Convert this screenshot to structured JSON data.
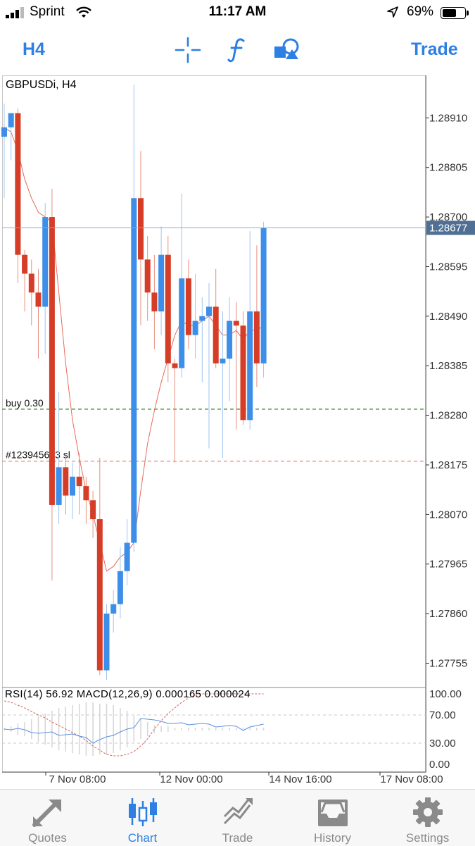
{
  "status": {
    "carrier": "Sprint",
    "time": "11:17 AM",
    "battery": "69%",
    "battery_level": 0.69
  },
  "toolbar": {
    "timeframe": "H4",
    "trade_label": "Trade",
    "icons": [
      "crosshair-icon",
      "function-icon",
      "objects-icon"
    ]
  },
  "chart": {
    "symbol_label": "GBPUSDi, H4",
    "indicator_label": "RSI(14) 56.92 MACD(12,26,9) 0.000165 0.000024",
    "current_price": "1.28677",
    "price_ticks": [
      "1.28910",
      "1.28805",
      "1.28700",
      "1.28595",
      "1.28490",
      "1.28385",
      "1.28280",
      "1.28175",
      "1.28070",
      "1.27965",
      "1.27860",
      "1.27755"
    ],
    "indicator_ticks": [
      "100.00",
      "70.00",
      "30.00",
      "0.00"
    ],
    "time_ticks": [
      "7 Nov 08:00",
      "12 Nov 00:00",
      "14 Nov 16:00",
      "17 Nov 08:00"
    ],
    "orders": [
      {
        "label": "buy 0.30",
        "price": 1.28293,
        "color": "#2e7d1e",
        "style": "dashed"
      },
      {
        "label": "#123945603 sl",
        "price": 1.28183,
        "color": "#f08070",
        "style": "dashed"
      }
    ],
    "colors": {
      "bull": "#3d8ee8",
      "bear": "#d63d27",
      "ma": "#e86a5a",
      "current": "#8da8c8",
      "axis": "#333333"
    }
  },
  "chart_data": {
    "type": "candlestick",
    "title": "GBPUSDi, H4",
    "ylim": [
      1.27705,
      1.29
    ],
    "candles": [
      {
        "o": 1.2887,
        "h": 1.2894,
        "l": 1.2874,
        "c": 1.2889
      },
      {
        "o": 1.2889,
        "h": 1.2891,
        "l": 1.2882,
        "c": 1.2892
      },
      {
        "o": 1.2892,
        "h": 1.2893,
        "l": 1.2856,
        "c": 1.2862
      },
      {
        "o": 1.2862,
        "h": 1.2863,
        "l": 1.285,
        "c": 1.2858
      },
      {
        "o": 1.2858,
        "h": 1.2861,
        "l": 1.2847,
        "c": 1.2854
      },
      {
        "o": 1.2854,
        "h": 1.2859,
        "l": 1.284,
        "c": 1.2851
      },
      {
        "o": 1.2851,
        "h": 1.2873,
        "l": 1.2841,
        "c": 1.287
      },
      {
        "o": 1.287,
        "h": 1.2876,
        "l": 1.2793,
        "c": 1.2809
      },
      {
        "o": 1.2809,
        "h": 1.2833,
        "l": 1.2805,
        "c": 1.2817
      },
      {
        "o": 1.2817,
        "h": 1.282,
        "l": 1.2807,
        "c": 1.2811
      },
      {
        "o": 1.2811,
        "h": 1.2818,
        "l": 1.2806,
        "c": 1.2815
      },
      {
        "o": 1.2815,
        "h": 1.282,
        "l": 1.2807,
        "c": 1.2813
      },
      {
        "o": 1.2813,
        "h": 1.2815,
        "l": 1.2805,
        "c": 1.281
      },
      {
        "o": 1.281,
        "h": 1.2812,
        "l": 1.2802,
        "c": 1.2806
      },
      {
        "o": 1.2806,
        "h": 1.2819,
        "l": 1.2773,
        "c": 1.2774
      },
      {
        "o": 1.2774,
        "h": 1.2788,
        "l": 1.2772,
        "c": 1.2786
      },
      {
        "o": 1.2786,
        "h": 1.2791,
        "l": 1.2782,
        "c": 1.2788
      },
      {
        "o": 1.2788,
        "h": 1.28,
        "l": 1.2785,
        "c": 1.2795
      },
      {
        "o": 1.2795,
        "h": 1.2806,
        "l": 1.2792,
        "c": 1.2801
      },
      {
        "o": 1.2801,
        "h": 1.2898,
        "l": 1.2799,
        "c": 1.2874
      },
      {
        "o": 1.2874,
        "h": 1.2884,
        "l": 1.2847,
        "c": 1.2861
      },
      {
        "o": 1.2861,
        "h": 1.2866,
        "l": 1.2848,
        "c": 1.2854
      },
      {
        "o": 1.2854,
        "h": 1.2862,
        "l": 1.2842,
        "c": 1.285
      },
      {
        "o": 1.285,
        "h": 1.2868,
        "l": 1.2845,
        "c": 1.2862
      },
      {
        "o": 1.2862,
        "h": 1.2866,
        "l": 1.2835,
        "c": 1.2839
      },
      {
        "o": 1.2839,
        "h": 1.284,
        "l": 1.2818,
        "c": 1.2838
      },
      {
        "o": 1.2838,
        "h": 1.2875,
        "l": 1.2836,
        "c": 1.2857
      },
      {
        "o": 1.2857,
        "h": 1.2861,
        "l": 1.2842,
        "c": 1.2845
      },
      {
        "o": 1.2845,
        "h": 1.2858,
        "l": 1.284,
        "c": 1.2848
      },
      {
        "o": 1.2848,
        "h": 1.2853,
        "l": 1.2835,
        "c": 1.2849
      },
      {
        "o": 1.2849,
        "h": 1.2856,
        "l": 1.2821,
        "c": 1.2851
      },
      {
        "o": 1.2851,
        "h": 1.2859,
        "l": 1.2838,
        "c": 1.2839
      },
      {
        "o": 1.2839,
        "h": 1.285,
        "l": 1.2819,
        "c": 1.284
      },
      {
        "o": 1.284,
        "h": 1.2853,
        "l": 1.2831,
        "c": 1.2848
      },
      {
        "o": 1.2848,
        "h": 1.2852,
        "l": 1.2825,
        "c": 1.2847
      },
      {
        "o": 1.2847,
        "h": 1.285,
        "l": 1.2826,
        "c": 1.2827
      },
      {
        "o": 1.2827,
        "h": 1.2867,
        "l": 1.2825,
        "c": 1.285
      },
      {
        "o": 1.285,
        "h": 1.2864,
        "l": 1.2834,
        "c": 1.2839
      },
      {
        "o": 1.2839,
        "h": 1.2869,
        "l": 1.2836,
        "c": 1.28677
      }
    ],
    "rsi_series": [
      50,
      49,
      51,
      49,
      45,
      44,
      45,
      46,
      41,
      42,
      43,
      40,
      38,
      30,
      35,
      39,
      41,
      46,
      50,
      52,
      65,
      64,
      63,
      61,
      58,
      58,
      59,
      56,
      57,
      58,
      57,
      53,
      54,
      55,
      54,
      48,
      53,
      55,
      57
    ],
    "macd_hist": [
      2,
      4,
      8,
      10,
      14,
      18,
      22,
      26,
      30,
      32,
      34,
      36,
      38,
      38,
      36,
      36,
      34,
      30,
      26,
      18,
      14,
      10,
      6,
      4,
      4,
      2,
      2,
      2,
      2,
      2,
      2,
      2,
      2,
      2,
      2,
      2,
      2,
      2,
      2
    ],
    "macd_signal": [
      90,
      88,
      84,
      80,
      75,
      70,
      66,
      60,
      55,
      50,
      45,
      40,
      34,
      26,
      20,
      14,
      12,
      12,
      14,
      18,
      26,
      36,
      50,
      62,
      72,
      80,
      88,
      94,
      98,
      100,
      100,
      100,
      100,
      100,
      100,
      100,
      100,
      100,
      100
    ],
    "ma_series": [
      1.2889,
      1.2888,
      1.2884,
      1.2878,
      1.2874,
      1.2871,
      1.287,
      1.2869,
      1.2854,
      1.2839,
      1.2827,
      1.2819,
      1.2812,
      1.2807,
      1.2801,
      1.2795,
      1.2796,
      1.2798,
      1.2799,
      1.2801,
      1.2812,
      1.2822,
      1.2829,
      1.2835,
      1.284,
      1.2845,
      1.2848,
      1.2847,
      1.2847,
      1.2848,
      1.2849,
      1.2847,
      1.2845,
      1.2845,
      1.2846,
      1.2844,
      1.2846,
      1.2846,
      1.2847
    ]
  },
  "tabs": [
    {
      "label": "Quotes",
      "icon": "quotes-icon",
      "active": false
    },
    {
      "label": "Chart",
      "icon": "chart-icon",
      "active": true
    },
    {
      "label": "Trade",
      "icon": "trade-icon",
      "active": false
    },
    {
      "label": "History",
      "icon": "history-icon",
      "active": false
    },
    {
      "label": "Settings",
      "icon": "settings-icon",
      "active": false
    }
  ]
}
